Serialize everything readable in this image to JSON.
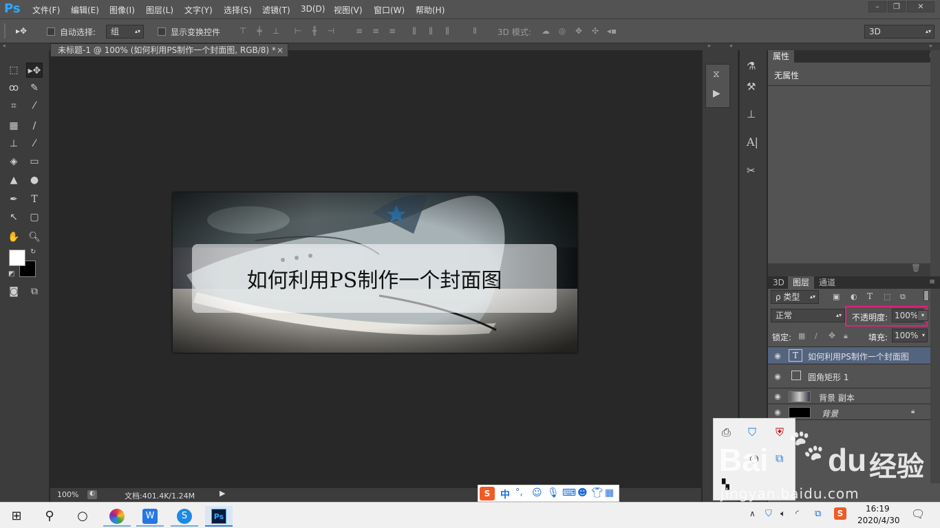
{
  "app": {
    "logo": "Ps",
    "menu": [
      "文件(F)",
      "编辑(E)",
      "图像(I)",
      "图层(L)",
      "文字(Y)",
      "选择(S)",
      "滤镜(T)",
      "3D(D)",
      "视图(V)",
      "窗口(W)",
      "帮助(H)"
    ],
    "window_controls": {
      "minimize": "–",
      "restore": "❐",
      "close": "✕"
    }
  },
  "options": {
    "auto_select_label": "自动选择:",
    "auto_select_value": "组",
    "show_transform_label": "显示变换控件",
    "mode_3d_label": "3D 模式:",
    "workspace_value": "3D"
  },
  "document": {
    "tab_title": "未标题-1 @ 100% (如何利用PS制作一个封面图, RGB/8) *",
    "tab_close": "×",
    "cover_text": "如何利用PS制作一个封面图",
    "zoom": "100%",
    "doc_info": "文档:401.4K/1.24M"
  },
  "properties": {
    "tab_label": "属性",
    "content": "无属性"
  },
  "layers": {
    "tabs": [
      "3D",
      "图层",
      "通道"
    ],
    "filter_label": "ρ 类型",
    "blend_mode": "正常",
    "opacity_label": "不透明度:",
    "opacity_value": "100%",
    "lock_label": "锁定:",
    "fill_label": "填充:",
    "fill_value": "100%",
    "items": [
      {
        "name": "如何利用PS制作一个封面图",
        "kind": "text",
        "selected": true
      },
      {
        "name": "圆角矩形 1",
        "kind": "shape",
        "selected": false
      },
      {
        "name": "背景 副本",
        "kind": "image",
        "selected": false
      },
      {
        "name": "背景",
        "kind": "background",
        "selected": false
      }
    ]
  },
  "ime": {
    "logo": "S",
    "mode": "中",
    "punct": "°,"
  },
  "taskbar": {
    "time": "16:19",
    "date": "2020/4/30"
  },
  "watermark": {
    "brand_latin": "Bai",
    "brand_latin2": "du",
    "brand_cn": "经验",
    "url": "jingyan.baidu.com"
  },
  "colors": {
    "highlight": "#e2207e",
    "selected_layer": "#53647f",
    "ps_blue": "#31a8ff"
  }
}
